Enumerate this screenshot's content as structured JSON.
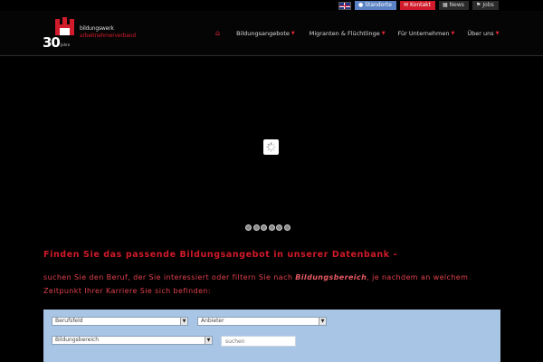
{
  "topbar": {
    "flag_icon": "uk-flag-icon",
    "standorte": "Standorte",
    "kontakt": "Kontakt",
    "news": "News",
    "jobs": "Jobs"
  },
  "logo": {
    "anniversary": "30",
    "sub": "Jahre",
    "line1": "bildungswerk",
    "line2": "arbeitnehmerverband"
  },
  "nav": {
    "items": [
      {
        "label": "Bildungsangebote"
      },
      {
        "label": "Migranten & Flüchtlinge"
      },
      {
        "label": "Für Unternehmen"
      },
      {
        "label": "Über uns"
      }
    ]
  },
  "slider": {
    "dot_count": 6
  },
  "intro": {
    "headline": "Finden Sie das passende Bildungsangebot in unserer Datenbank -",
    "text_part1": "suchen Sie den Beruf, der Sie interessiert oder filtern Sie nach ",
    "emphasis": "Bildungsbereich",
    "text_part2": ", je nachdem an welchem Zeitpunkt Ihrer Karriere Sie sich befinden:"
  },
  "search": {
    "berufsfeld": "Berufsfeld",
    "anbieter": "Anbieter",
    "bildungsbereich": "Bildungsbereich",
    "placeholder": "suchen"
  },
  "colors": {
    "accent_red": "#d11a2a",
    "panel_blue": "#a9c5e6",
    "standorte_blue": "#5b82c4"
  }
}
